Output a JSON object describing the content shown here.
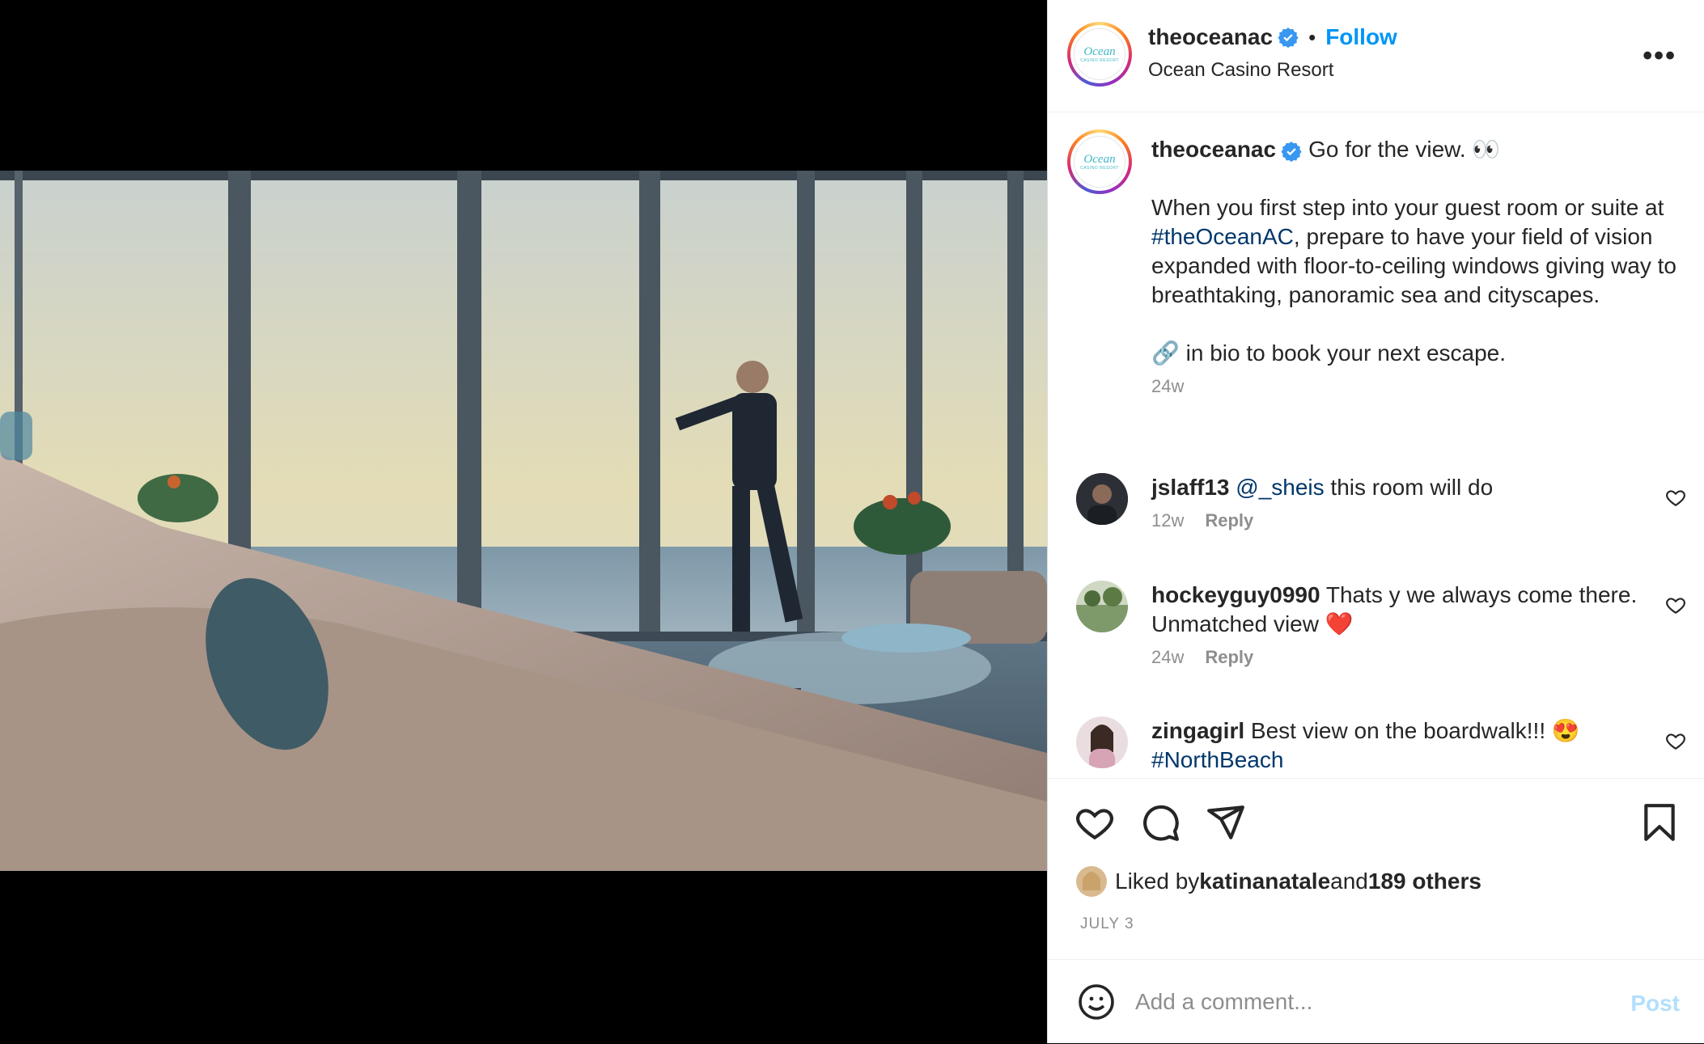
{
  "post": {
    "username": "theoceanac",
    "verified": true,
    "follow_label": "Follow",
    "separator": "•",
    "location": "Ocean Casino Resort",
    "more_label": "•••",
    "logo_text": "Ocean",
    "logo_subtext": "CASINO RESORT"
  },
  "caption": {
    "username": "theoceanac",
    "first_line": "Go for the view. 👀",
    "para1_before": "When you first step into your guest room or suite at ",
    "para1_hashtag": "#theOceanAC",
    "para1_after": ", prepare to have your field of vision expanded with floor-to-ceiling windows giving way to breathtaking, panoramic sea and cityscapes.",
    "para2": "🔗 in bio to book your next escape.",
    "time": "24w"
  },
  "comments": [
    {
      "username": "jslaff13",
      "mention": "@_sheis",
      "text": " this room will do",
      "time": "12w",
      "reply": "Reply"
    },
    {
      "username": "hockeyguy0990",
      "text": "Thats y we always come there. Unmatched view ❤️",
      "time": "24w",
      "reply": "Reply"
    },
    {
      "username": "zingagirl",
      "text": "Best view on the boardwalk!!! 😍",
      "hashtag": "#NorthBeach"
    }
  ],
  "likes": {
    "prefix": "Liked by ",
    "user": "katinanatale",
    "mid": " and ",
    "others": "189 others"
  },
  "date": "JULY 3",
  "add_comment": {
    "placeholder": "Add a comment...",
    "post_label": "Post"
  },
  "icons": [
    "verified-badge-icon",
    "more-options-icon",
    "heart-icon",
    "comment-icon",
    "share-icon",
    "bookmark-icon",
    "emoji-icon"
  ],
  "colors": {
    "link": "#0095f6",
    "hashtag": "#00376b",
    "muted": "#8e8e8e",
    "post_disabled": "#b2dffc"
  }
}
